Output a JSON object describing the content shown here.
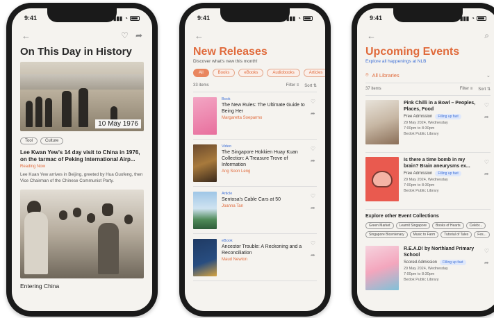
{
  "status_time": "9:41",
  "phone1": {
    "title": "On This Day in History",
    "photo_date": "10 May 1976",
    "tags": [
      "Tool",
      "Culture"
    ],
    "article_title": "Lee Kwan Yew's 14 day visit to China in 1976, on the tarmac of Peking International Airp...",
    "article_link": "Reading Now",
    "article_body": "Lee Kuan Yew arrives in Beijing, greeted by Hua Guofeng, then Vice Chairman of the Chinese Communist Party.",
    "second_caption": "Entering China"
  },
  "phone2": {
    "title": "New Releases",
    "subtitle": "Discover what's new this month!",
    "chips": [
      "All",
      "Books",
      "eBooks",
      "Audiobooks",
      "Articles"
    ],
    "count": "33 items",
    "filter_label": "Filter",
    "sort_label": "Sort",
    "items": [
      {
        "type": "Book",
        "title": "The New Rules: The Ultimate Guide to Being Her",
        "author": "Margaretta Soeparmo"
      },
      {
        "type": "Video",
        "title": "The Singapore Hokkien Huay Kuan Collection: A Treasure Trove of Information",
        "author": "Ang Soon Leng"
      },
      {
        "type": "Article",
        "title": "Sentosa's Cable Cars at 50",
        "author": "Joanna Tan"
      },
      {
        "type": "eBook",
        "title": "Ancestor Trouble: A Reckoning and a Reconciliation",
        "author": "Maud Newton"
      }
    ]
  },
  "phone3": {
    "title": "Upcoming Events",
    "subtitle": "Explore all happenings at NLB",
    "library_select": "All Libraries",
    "count": "37 items",
    "filter_label": "Filter",
    "sort_label": "Sort",
    "events": [
      {
        "title": "Pink Chilli in a Bowl – Peoples, Places, Food",
        "admission": "Free Admission",
        "badge": "Filling up fast",
        "lines": [
          "29 May 2024, Wednesday",
          "7:00pm to 8:30pm",
          "Bedok Public Library"
        ]
      },
      {
        "title": "Is there a time bomb in my brain? Brain aneurysms ex...",
        "admission": "Free Admission",
        "badge": "Filling up fast",
        "lines": [
          "29 May 2024, Wednesday",
          "7:00pm to 8:30pm",
          "Bedok Public Library"
        ]
      },
      {
        "title": "R.E.A.D! by Northland Primary School",
        "admission": "Scored Admission",
        "badge": "Filling up fast",
        "lines": [
          "29 May 2024, Wednesday",
          "7:00pm to 8:30pm",
          "Bedok Public Library"
        ]
      }
    ],
    "collections_title": "Explore other Event Collections",
    "collections": [
      "Green Market",
      "Learnit Singapore",
      "Books of Hearts",
      "Celebr...",
      "Singapore Bicentenary",
      "Music to Farm",
      "Tutorial of Tales",
      "Fes..."
    ]
  }
}
